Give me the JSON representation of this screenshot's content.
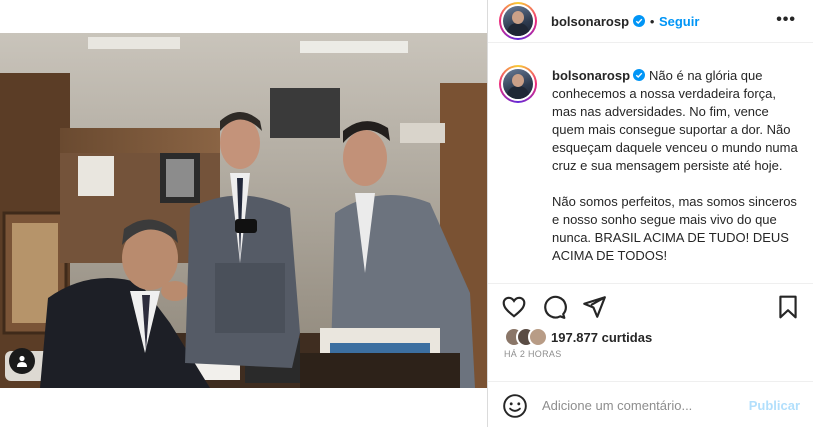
{
  "post": {
    "username": "bolsonarosp",
    "verified": true,
    "separator": "•",
    "follow_label": "Seguir",
    "more_label": "•••"
  },
  "caption": {
    "username": "bolsonarosp",
    "paragraph1": "Não é na glória que conhecemos a nossa verdadeira força, mas nas adversidades. No fim, vence quem mais consegue suportar a dor. Não esqueçam daquele venceu o mundo numa cruz e sua mensagem persiste até hoje.",
    "paragraph2": "Não somos perfeitos, mas somos sinceros e nosso sonho segue mais vivo do que nunca. BRASIL ACIMA DE TUDO! DEUS ACIMA DE TODOS!"
  },
  "actions": {
    "icons": [
      "heart-icon",
      "comment-icon",
      "share-icon",
      "bookmark-icon"
    ]
  },
  "likes": {
    "count": "197.877",
    "label": "curtidas"
  },
  "time": {
    "label": "HÁ 2 HORAS"
  },
  "comment": {
    "placeholder": "Adicione um comentário...",
    "publish_label": "Publicar"
  },
  "colors": {
    "accent": "#0095f6",
    "publish_disabled": "#b2dffc",
    "text": "#262626",
    "muted": "#8e8e8e",
    "border": "#dbdbdb"
  }
}
